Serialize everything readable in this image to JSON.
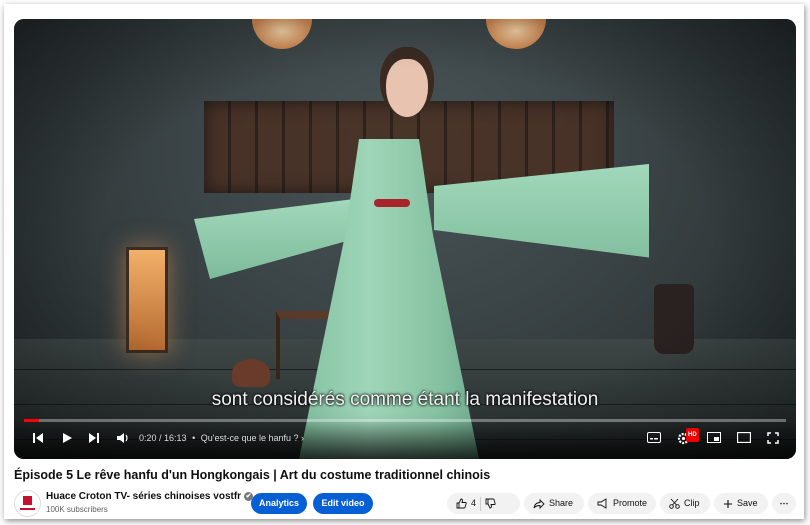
{
  "video": {
    "subtitle": "sont considérés comme étant la manifestation",
    "progress_fraction": 0.02,
    "time": "0:20 / 16:13",
    "chapter": "Qu'est-ce que le hanfu ?",
    "hd_badge": "HD"
  },
  "title": "Épisode 5 Le rêve hanfu d'un Hongkongais | Art du costume traditionnel chinois",
  "channel": {
    "name": "Huace Croton TV- séries chinoises vostfr",
    "subscribers": "100K subscribers",
    "verified_icon": "✔"
  },
  "actions": {
    "analytics": "Analytics",
    "edit_video": "Edit video",
    "likes": "4",
    "share": "Share",
    "promote": "Promote",
    "clip": "Clip",
    "save": "Save",
    "more": "⋯"
  },
  "colors": {
    "brand_blue": "#065fd4",
    "progress_red": "#ff0000"
  }
}
